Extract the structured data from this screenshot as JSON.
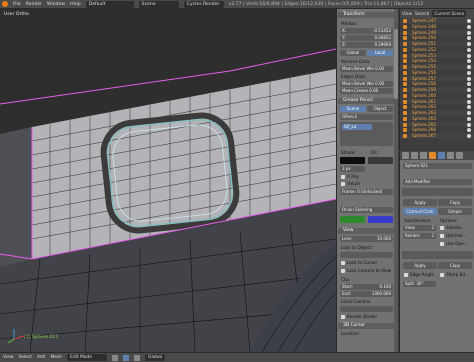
{
  "topbar": {
    "menus": [
      "File",
      "Render",
      "Window",
      "Help"
    ],
    "screen": "Default",
    "scene": "Scene",
    "engine": "Cycles Render",
    "stats": "v2.77 | Verts:16/6,894 | Edges:16/12,930 | Faces:0/5,859 | Tris:11,867 | Objects:1/12"
  },
  "viewport": {
    "view_name": "User Ortho",
    "object_label": "(1) Sphere.021"
  },
  "npanel": {
    "transform": {
      "header": "Transform",
      "median": "Median:",
      "x": "-0.51452",
      "y": "0.06852",
      "z": "0.29669",
      "global": "Global",
      "local": "Local"
    },
    "vertices_data": {
      "header": "Vertices Data:",
      "mean_bevel_weight": "Mean Bevel Wei 0.00"
    },
    "edges_data": {
      "header": "Edges Data:",
      "mean_bevel": "Mean Bevel Wei 0.00",
      "mean_crease": "Mean Crease 0.00"
    },
    "grease_pencil": {
      "header": "Grease Pencil",
      "scene": "Scene",
      "object": "Object",
      "gpencil": "GPencil",
      "layer": "GP_La",
      "stroke": "Stroke:",
      "fill": "Fill:",
      "thickness": "3 px",
      "x_ray": "X Ray",
      "volumetric": "Volum",
      "frame": "Frame: 0 (Unlocked)",
      "onion": "Onion Skinning"
    },
    "view": {
      "header": "View",
      "lens_label": "Lens:",
      "lens": "35.000",
      "lock_object": "Lock to Object:",
      "lock_cursor": "Lock to Cursor",
      "lock_camera": "Lock Camera to View",
      "clip": "Clip:",
      "start_label": "Start:",
      "start": "0.100",
      "end_label": "End:",
      "end": "1000.000",
      "local_camera": "Local Camera:",
      "render_border": "Render Border"
    },
    "cursor": {
      "header": "3D Cursor",
      "location": "Location:"
    }
  },
  "outliner": {
    "view_label": "View",
    "search_label": "Search",
    "filter": "Current Scene",
    "items": [
      "Sphere.247",
      "Sphere.248",
      "Sphere.249",
      "Sphere.250",
      "Sphere.251",
      "Sphere.252",
      "Sphere.253",
      "Sphere.254",
      "Sphere.255",
      "Sphere.256",
      "Sphere.257",
      "Sphere.258",
      "Sphere.259",
      "Sphere.260",
      "Sphere.261",
      "Sphere.262",
      "Sphere.263",
      "Sphere.264",
      "Sphere.265",
      "Sphere.266",
      "Sphere.267"
    ]
  },
  "properties": {
    "object_name": "Sphere.021",
    "add_modifier": "Add Modifier",
    "mod1": {
      "apply": "Apply",
      "copy": "Copy",
      "catmull": "Catmull-Clark",
      "simple": "Simple",
      "subdivisions": "Subdivisions:",
      "options": "Options:",
      "view": "View:",
      "view_val": "2",
      "render": "Render:",
      "render_val": "2",
      "subdivide": "Subdivi...",
      "optimal": "Optimal...",
      "use_opensubdiv": "Use Ope..."
    },
    "mod2": {
      "apply": "Apply",
      "copy": "Copy",
      "edge_angle": "Edge Angle",
      "sharp_edges": "Sharp Ed...",
      "split": "Split: 30°"
    }
  },
  "statusbar": {
    "items": [
      "View",
      "Select",
      "Add",
      "Mesh"
    ],
    "mode": "Edit Mode",
    "pivot": "Global"
  },
  "colors": {
    "accent": "#5f7fae",
    "selected_edge": "#e85ce8",
    "outliner_item": "#f0a84a",
    "stroke_color": "#0d0d0d",
    "fill_color": "#3a3a3a",
    "swatch_green": "#2c8a2c",
    "swatch_blue": "#3a3ac8"
  },
  "icons": [
    "blender-logo-icon",
    "eye-icon",
    "mesh-icon",
    "wrench-icon",
    "camera-icon",
    "vertex-select-icon",
    "edge-select-icon",
    "face-select-icon"
  ]
}
